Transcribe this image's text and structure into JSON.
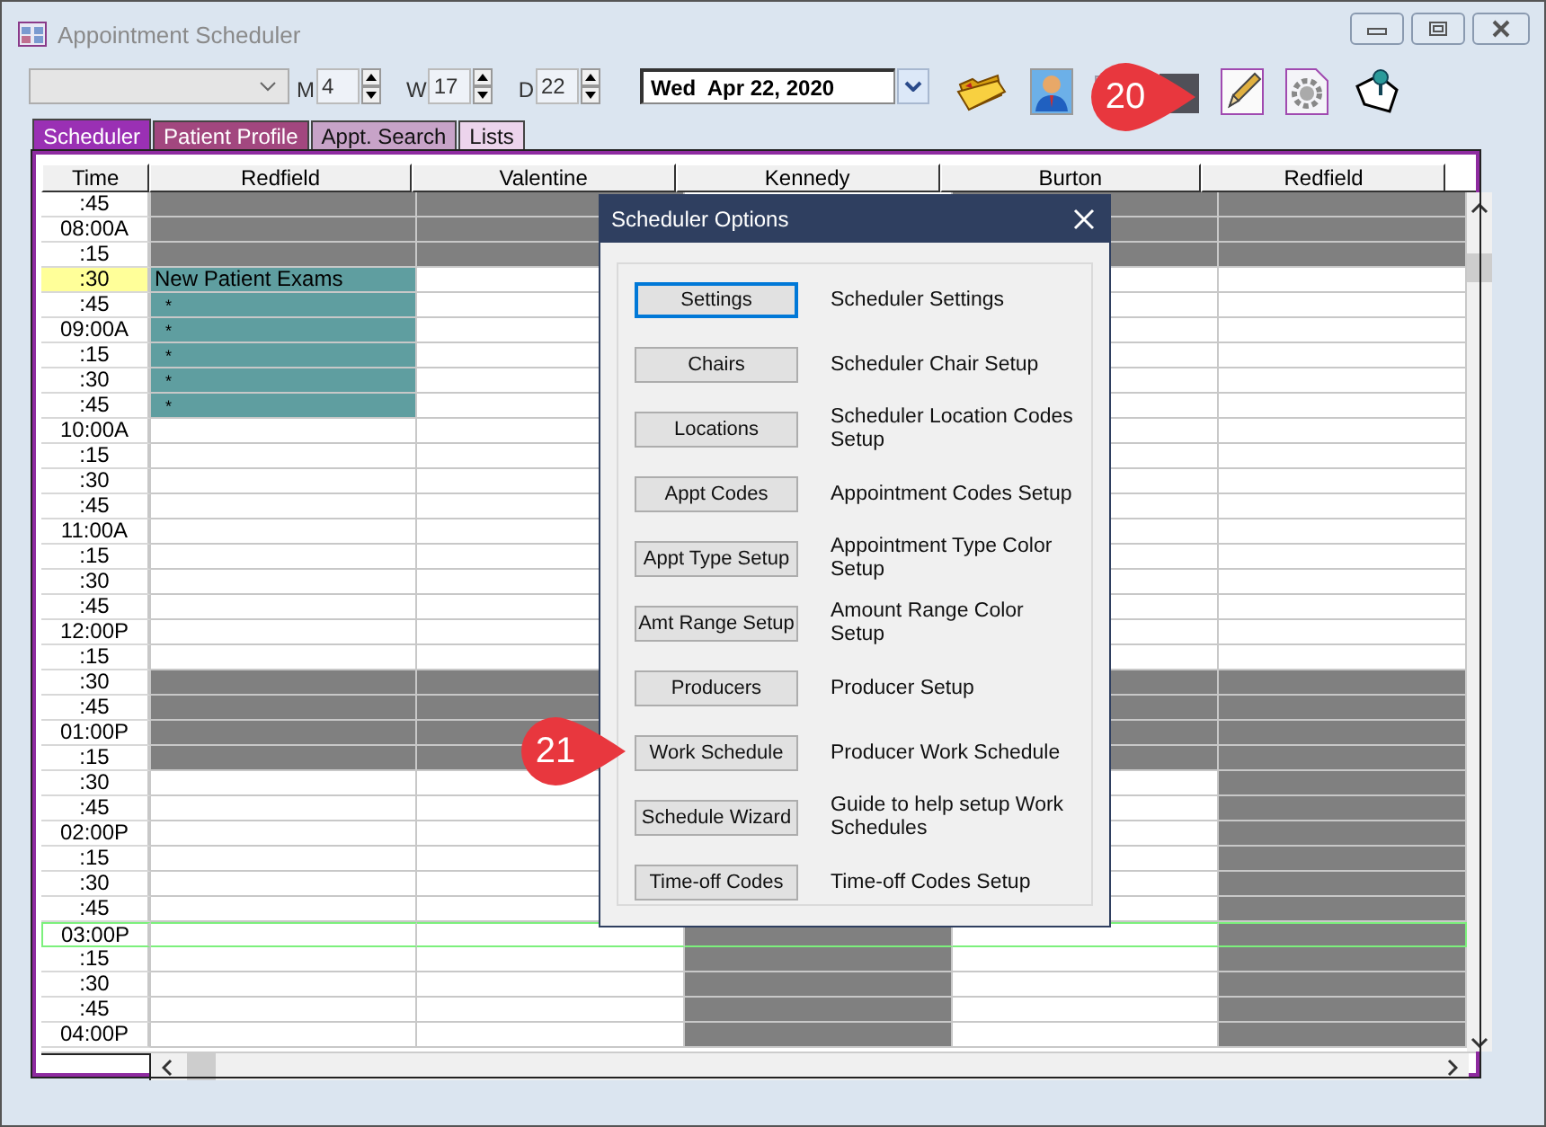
{
  "window": {
    "title": "Appointment Scheduler"
  },
  "toolbar": {
    "month": {
      "label": "M",
      "value": "4"
    },
    "week": {
      "label": "W",
      "value": "17"
    },
    "day": {
      "label": "D",
      "value": "22"
    },
    "date": {
      "value": "Wed  Apr 22, 2020"
    }
  },
  "tabs": [
    {
      "label": "Scheduler",
      "selected": true,
      "color": "#9a30b4"
    },
    {
      "label": "Patient Profile",
      "selected": false,
      "color": "#a2477f"
    },
    {
      "label": "Appt. Search",
      "selected": false,
      "color": "#c7a3c8"
    },
    {
      "label": "Lists",
      "selected": false,
      "color": "#ecd4ec"
    }
  ],
  "grid": {
    "columns": [
      "Time",
      "Redfield",
      "Valentine",
      "Kennedy",
      "Burton",
      "Redfield"
    ],
    "rows": [
      {
        "time": ":45",
        "current": false,
        "focused": false,
        "cells": [
          {
            "kind": "blocked"
          },
          {
            "kind": "blocked"
          },
          null,
          {
            "kind": "blocked"
          },
          {
            "kind": "blocked"
          }
        ]
      },
      {
        "time": "08:00A",
        "current": false,
        "focused": false,
        "cells": [
          {
            "kind": "blocked"
          },
          {
            "kind": "blocked"
          },
          null,
          {
            "kind": "blocked"
          },
          {
            "kind": "blocked"
          }
        ]
      },
      {
        "time": ":15",
        "current": false,
        "focused": false,
        "cells": [
          {
            "kind": "blocked"
          },
          {
            "kind": "blocked"
          },
          null,
          {
            "kind": "blocked"
          },
          {
            "kind": "blocked"
          }
        ]
      },
      {
        "time": ":30",
        "current": true,
        "focused": false,
        "cells": [
          {
            "kind": "appt",
            "text": "New Patient Exams"
          },
          {
            "kind": "open"
          },
          null,
          {
            "kind": "open"
          },
          {
            "kind": "open"
          }
        ]
      },
      {
        "time": ":45",
        "current": false,
        "focused": false,
        "cells": [
          {
            "kind": "appt",
            "text": "*"
          },
          {
            "kind": "open"
          },
          null,
          {
            "kind": "open"
          },
          {
            "kind": "open"
          }
        ]
      },
      {
        "time": "09:00A",
        "current": false,
        "focused": false,
        "cells": [
          {
            "kind": "appt",
            "text": "*"
          },
          {
            "kind": "open"
          },
          null,
          {
            "kind": "open"
          },
          {
            "kind": "open"
          }
        ]
      },
      {
        "time": ":15",
        "current": false,
        "focused": false,
        "cells": [
          {
            "kind": "appt",
            "text": "*"
          },
          {
            "kind": "open"
          },
          null,
          {
            "kind": "open"
          },
          {
            "kind": "open"
          }
        ]
      },
      {
        "time": ":30",
        "current": false,
        "focused": false,
        "cells": [
          {
            "kind": "appt",
            "text": "*"
          },
          {
            "kind": "open"
          },
          null,
          {
            "kind": "open"
          },
          {
            "kind": "open"
          }
        ]
      },
      {
        "time": ":45",
        "current": false,
        "focused": false,
        "cells": [
          {
            "kind": "appt",
            "text": "*"
          },
          {
            "kind": "open"
          },
          null,
          {
            "kind": "open"
          },
          {
            "kind": "open"
          }
        ]
      },
      {
        "time": "10:00A",
        "current": false,
        "focused": false,
        "cells": [
          {
            "kind": "open"
          },
          {
            "kind": "open"
          },
          null,
          {
            "kind": "open"
          },
          {
            "kind": "open"
          }
        ]
      },
      {
        "time": ":15",
        "current": false,
        "focused": false,
        "cells": [
          {
            "kind": "open"
          },
          {
            "kind": "open"
          },
          null,
          {
            "kind": "open"
          },
          {
            "kind": "open"
          }
        ]
      },
      {
        "time": ":30",
        "current": false,
        "focused": false,
        "cells": [
          {
            "kind": "open"
          },
          {
            "kind": "open"
          },
          null,
          {
            "kind": "open"
          },
          {
            "kind": "open"
          }
        ]
      },
      {
        "time": ":45",
        "current": false,
        "focused": false,
        "cells": [
          {
            "kind": "open"
          },
          {
            "kind": "open"
          },
          null,
          {
            "kind": "open"
          },
          {
            "kind": "open"
          }
        ]
      },
      {
        "time": "11:00A",
        "current": false,
        "focused": false,
        "cells": [
          {
            "kind": "open"
          },
          {
            "kind": "open"
          },
          null,
          {
            "kind": "open"
          },
          {
            "kind": "open"
          }
        ]
      },
      {
        "time": ":15",
        "current": false,
        "focused": false,
        "cells": [
          {
            "kind": "open"
          },
          {
            "kind": "open"
          },
          null,
          {
            "kind": "open"
          },
          {
            "kind": "open"
          }
        ]
      },
      {
        "time": ":30",
        "current": false,
        "focused": false,
        "cells": [
          {
            "kind": "open"
          },
          {
            "kind": "open"
          },
          null,
          {
            "kind": "open"
          },
          {
            "kind": "open"
          }
        ]
      },
      {
        "time": ":45",
        "current": false,
        "focused": false,
        "cells": [
          {
            "kind": "open"
          },
          {
            "kind": "open"
          },
          null,
          {
            "kind": "open"
          },
          {
            "kind": "open"
          }
        ]
      },
      {
        "time": "12:00P",
        "current": false,
        "focused": false,
        "cells": [
          {
            "kind": "open"
          },
          {
            "kind": "open"
          },
          null,
          {
            "kind": "open"
          },
          {
            "kind": "open"
          }
        ]
      },
      {
        "time": ":15",
        "current": false,
        "focused": false,
        "cells": [
          {
            "kind": "open"
          },
          {
            "kind": "open"
          },
          null,
          {
            "kind": "open"
          },
          {
            "kind": "open"
          }
        ]
      },
      {
        "time": ":30",
        "current": false,
        "focused": false,
        "cells": [
          {
            "kind": "blocked"
          },
          {
            "kind": "blocked"
          },
          null,
          {
            "kind": "blocked"
          },
          {
            "kind": "blocked"
          }
        ]
      },
      {
        "time": ":45",
        "current": false,
        "focused": false,
        "cells": [
          {
            "kind": "blocked"
          },
          {
            "kind": "blocked"
          },
          null,
          {
            "kind": "blocked"
          },
          {
            "kind": "blocked"
          }
        ]
      },
      {
        "time": "01:00P",
        "current": false,
        "focused": false,
        "cells": [
          {
            "kind": "blocked"
          },
          {
            "kind": "blocked"
          },
          null,
          {
            "kind": "blocked"
          },
          {
            "kind": "blocked"
          }
        ]
      },
      {
        "time": ":15",
        "current": false,
        "focused": false,
        "cells": [
          {
            "kind": "blocked"
          },
          {
            "kind": "blocked"
          },
          null,
          {
            "kind": "blocked"
          },
          {
            "kind": "blocked"
          }
        ]
      },
      {
        "time": ":30",
        "current": false,
        "focused": false,
        "cells": [
          {
            "kind": "open"
          },
          {
            "kind": "open"
          },
          null,
          {
            "kind": "open"
          },
          {
            "kind": "blocked"
          }
        ]
      },
      {
        "time": ":45",
        "current": false,
        "focused": false,
        "cells": [
          {
            "kind": "open"
          },
          {
            "kind": "open"
          },
          null,
          {
            "kind": "open"
          },
          {
            "kind": "blocked"
          }
        ]
      },
      {
        "time": "02:00P",
        "current": false,
        "focused": false,
        "cells": [
          {
            "kind": "open"
          },
          {
            "kind": "open"
          },
          null,
          {
            "kind": "open"
          },
          {
            "kind": "blocked"
          }
        ]
      },
      {
        "time": ":15",
        "current": false,
        "focused": false,
        "cells": [
          {
            "kind": "open"
          },
          {
            "kind": "open"
          },
          null,
          {
            "kind": "open"
          },
          {
            "kind": "blocked"
          }
        ]
      },
      {
        "time": ":30",
        "current": false,
        "focused": false,
        "cells": [
          {
            "kind": "open"
          },
          {
            "kind": "open"
          },
          null,
          {
            "kind": "open"
          },
          {
            "kind": "blocked"
          }
        ]
      },
      {
        "time": ":45",
        "current": false,
        "focused": false,
        "cells": [
          {
            "kind": "open"
          },
          {
            "kind": "open"
          },
          null,
          {
            "kind": "open"
          },
          {
            "kind": "blocked"
          }
        ]
      },
      {
        "time": "03:00P",
        "current": false,
        "focused": true,
        "cells": [
          {
            "kind": "open"
          },
          {
            "kind": "open"
          },
          {
            "kind": "blocked"
          },
          {
            "kind": "open"
          },
          {
            "kind": "blocked"
          }
        ]
      },
      {
        "time": ":15",
        "current": false,
        "focused": false,
        "cells": [
          {
            "kind": "open"
          },
          {
            "kind": "open"
          },
          {
            "kind": "blocked"
          },
          {
            "kind": "open"
          },
          {
            "kind": "blocked"
          }
        ]
      },
      {
        "time": ":30",
        "current": false,
        "focused": false,
        "cells": [
          {
            "kind": "open"
          },
          {
            "kind": "open"
          },
          {
            "kind": "blocked"
          },
          {
            "kind": "open"
          },
          {
            "kind": "blocked"
          }
        ]
      },
      {
        "time": ":45",
        "current": false,
        "focused": false,
        "cells": [
          {
            "kind": "open"
          },
          {
            "kind": "open"
          },
          {
            "kind": "blocked"
          },
          {
            "kind": "open"
          },
          {
            "kind": "blocked"
          }
        ]
      },
      {
        "time": "04:00P",
        "current": false,
        "focused": false,
        "cells": [
          {
            "kind": "open"
          },
          {
            "kind": "open"
          },
          {
            "kind": "blocked"
          },
          {
            "kind": "open"
          },
          {
            "kind": "blocked"
          }
        ]
      }
    ]
  },
  "dialog": {
    "title": "Scheduler Options",
    "items": [
      {
        "button": "Settings",
        "description": "Scheduler Settings",
        "focused": true
      },
      {
        "button": "Chairs",
        "description": "Scheduler Chair Setup",
        "focused": false
      },
      {
        "button": "Locations",
        "description": "Scheduler Location Codes Setup",
        "focused": false
      },
      {
        "button": "Appt Codes",
        "description": "Appointment Codes Setup",
        "focused": false
      },
      {
        "button": "Appt Type Setup",
        "description": "Appointment Type Color Setup",
        "focused": false
      },
      {
        "button": "Amt Range Setup",
        "description": "Amount Range Color Setup",
        "focused": false
      },
      {
        "button": "Producers",
        "description": "Producer Setup",
        "focused": false
      },
      {
        "button": "Work Schedule",
        "description": "Producer Work Schedule",
        "focused": false
      },
      {
        "button": "Schedule Wizard",
        "description": "Guide to help setup Work Schedules",
        "focused": false
      },
      {
        "button": "Time-off Codes",
        "description": "Time-off Codes Setup",
        "focused": false
      }
    ]
  },
  "callouts": [
    {
      "text": "20"
    },
    {
      "text": "21"
    }
  ]
}
